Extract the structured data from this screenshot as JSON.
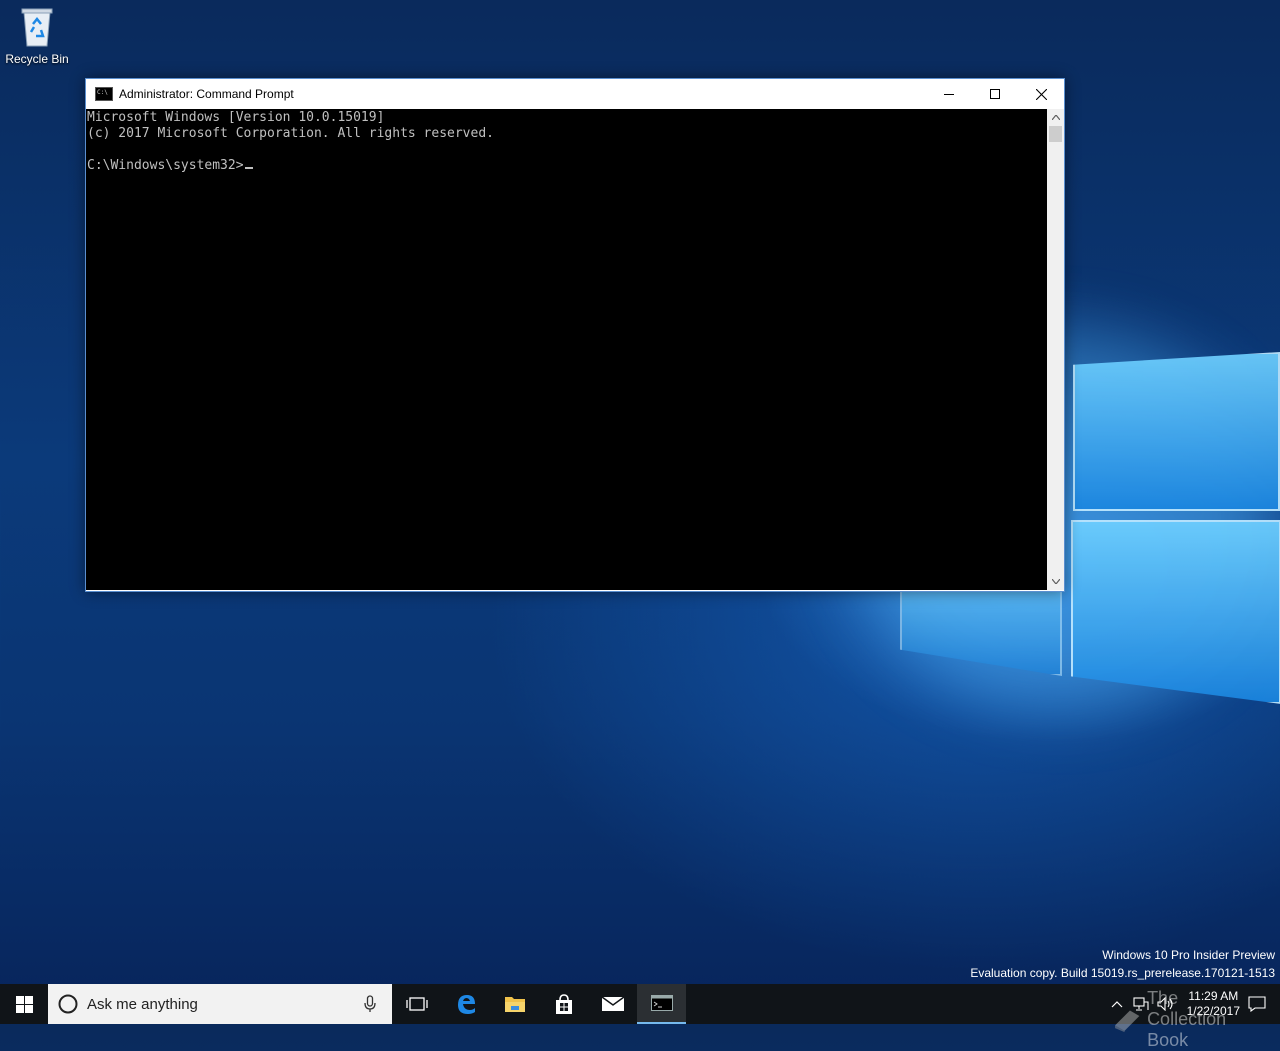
{
  "desktop": {
    "recycle_bin_label": "Recycle Bin"
  },
  "window": {
    "title": "Administrator: Command Prompt",
    "console_lines": [
      "Microsoft Windows [Version 10.0.15019]",
      "(c) 2017 Microsoft Corporation. All rights reserved.",
      "",
      "C:\\Windows\\system32>"
    ]
  },
  "watermark": {
    "line1": "Windows 10 Pro Insider Preview",
    "line2": "Evaluation copy. Build 15019.rs_prerelease.170121-1513"
  },
  "taskbar": {
    "search_placeholder": "Ask me anything",
    "pinned": [
      "task-view-icon",
      "edge-icon",
      "file-explorer-icon",
      "store-icon",
      "mail-icon",
      "command-prompt-icon"
    ],
    "clock_time": "11:29 AM",
    "clock_date": "1/22/2017",
    "overlay_text": "The Collection Book"
  },
  "colors": {
    "accent": "#76b9ed",
    "taskbar": "#101418",
    "console_bg": "#000000",
    "console_fg": "#c0c0c0"
  }
}
